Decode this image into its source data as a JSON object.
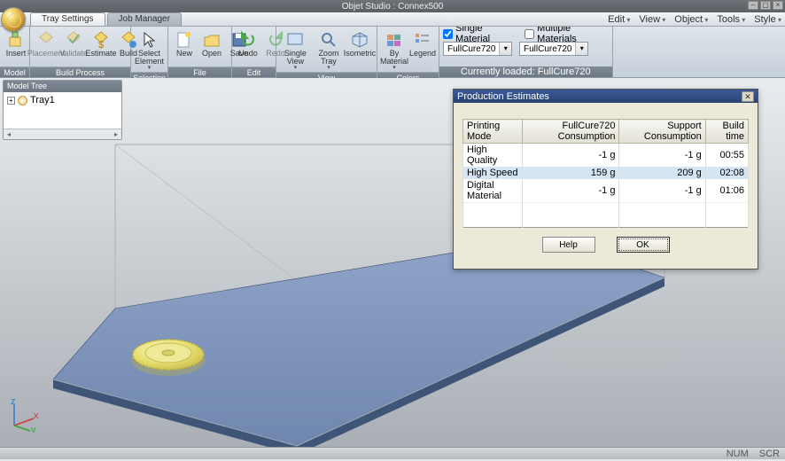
{
  "app_title": "Objet Studio : Connex500",
  "tabs": {
    "tray_settings": "Tray Settings",
    "job_manager": "Job Manager"
  },
  "menu_right": [
    "Edit",
    "View",
    "Object",
    "Tools",
    "Style"
  ],
  "ribbon": {
    "model": {
      "caption": "Model",
      "items": [
        {
          "id": "insert",
          "label": "Insert"
        }
      ]
    },
    "build_process": {
      "caption": "Build Process",
      "items": [
        {
          "id": "placement",
          "label": "Placement"
        },
        {
          "id": "validate",
          "label": "Validate"
        },
        {
          "id": "estimate",
          "label": "Estimate"
        },
        {
          "id": "build",
          "label": "Build"
        }
      ]
    },
    "selection": {
      "caption": "Selection",
      "items": [
        {
          "id": "select-element",
          "label": "Select Element"
        }
      ]
    },
    "file": {
      "caption": "File",
      "items": [
        {
          "id": "new",
          "label": "New"
        },
        {
          "id": "open",
          "label": "Open"
        },
        {
          "id": "save",
          "label": "Save"
        }
      ]
    },
    "edit": {
      "caption": "Edit",
      "items": [
        {
          "id": "undo",
          "label": "Undo"
        },
        {
          "id": "redo",
          "label": "Redo"
        }
      ]
    },
    "view": {
      "caption": "View",
      "items": [
        {
          "id": "single-view",
          "label": "Single View"
        },
        {
          "id": "zoom-tray",
          "label": "Zoom Tray"
        },
        {
          "id": "isometric",
          "label": "Isometric"
        }
      ]
    },
    "colors": {
      "caption": "Colors",
      "items": [
        {
          "id": "by-material",
          "label": "By Material"
        },
        {
          "id": "legend",
          "label": "Legend"
        }
      ]
    }
  },
  "materials": {
    "single": "Single Material",
    "multiple": "Multiple Materials",
    "single_checked": true,
    "multiple_checked": false,
    "left_select": "FullCure720",
    "right_select": "FullCure720",
    "loaded_caption": "Currently loaded: FullCure720"
  },
  "model_tree": {
    "title": "Model Tree",
    "items": [
      {
        "name": "Tray1"
      }
    ]
  },
  "dialog": {
    "title": "Production Estimates",
    "headers": [
      "Printing Mode",
      "FullCure720 Consumption",
      "Support Consumption",
      "Build time"
    ],
    "rows": [
      {
        "mode": "High Quality",
        "c1": "-1 g",
        "c2": "-1 g",
        "time": "00:55"
      },
      {
        "mode": "High Speed",
        "c1": "159 g",
        "c2": "209 g",
        "time": "02:08",
        "selected": true
      },
      {
        "mode": "Digital Material",
        "c1": "-1 g",
        "c2": "-1 g",
        "time": "01:06"
      }
    ],
    "help": "Help",
    "ok": "OK"
  },
  "status": {
    "num": "NUM",
    "scr": "SCR"
  },
  "axis": {
    "x": "x",
    "y": "y",
    "z": "z"
  }
}
